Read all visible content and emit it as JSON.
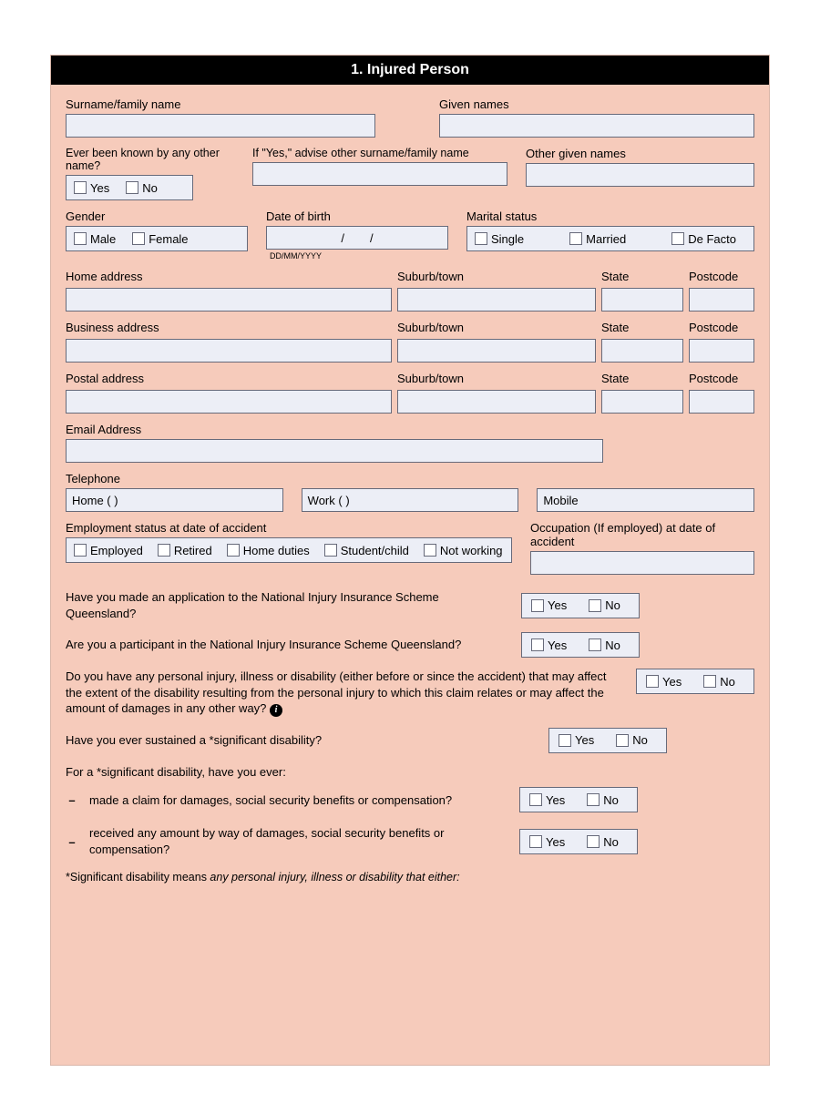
{
  "section_title": "1. Injured Person",
  "labels": {
    "surname": "Surname/family name",
    "given": "Given names",
    "other_name_q": "Ever been known by any other name?",
    "other_surname": "If \"Yes,\" advise other surname/family name",
    "other_given": "Other given names",
    "gender": "Gender",
    "dob": "Date of birth",
    "dob_hint": "DD/MM/YYYY",
    "marital": "Marital status",
    "home_addr": "Home address",
    "suburb": "Suburb/town",
    "state": "State",
    "postcode": "Postcode",
    "biz_addr": "Business address",
    "postal_addr": "Postal address",
    "email": "Email Address",
    "telephone": "Telephone",
    "tel_home": "Home (         )",
    "tel_work": "Work (         )",
    "tel_mobile": "Mobile",
    "emp_status": "Employment status at date of accident",
    "occupation": "Occupation (If employed) at date of accident"
  },
  "options": {
    "yes": "Yes",
    "no": "No",
    "male": "Male",
    "female": "Female",
    "single": "Single",
    "married": "Married",
    "defacto": "De Facto",
    "employed": "Employed",
    "retired": "Retired",
    "home_duties": "Home duties",
    "student": "Student/child",
    "not_working": "Not working"
  },
  "dob_sep": "/",
  "questions": {
    "niis_app": "Have you made an application to the National Injury Insurance Scheme Queensland?",
    "niis_part": "Are you a participant in the National Injury Insurance Scheme Queensland?",
    "disability_long": "Do you have any personal injury, illness or disability (either before or since the accident) that may affect the extent of the disability resulting from the personal injury to which this claim relates or may affect the amount of damages in any other way?",
    "sig_disability": "Have you ever sustained a *significant disability?",
    "sig_intro": "For a *significant disability, have you ever:",
    "sig_a": "made a claim for damages, social security benefits or compensation?",
    "sig_b": "received any amount by way of damages, social security benefits or compensation?"
  },
  "footnote_prefix": "*Significant disability means ",
  "footnote_italic": "any personal injury, illness or disability that either:"
}
